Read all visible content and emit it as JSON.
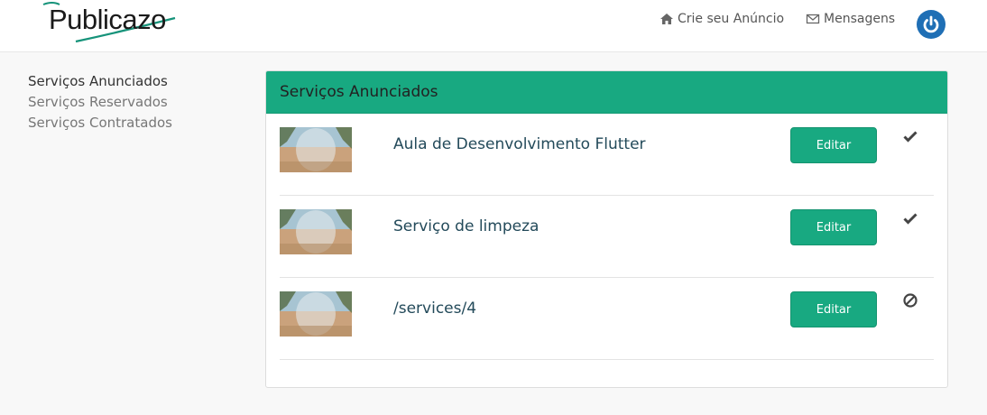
{
  "header": {
    "brand": "Publicazo",
    "nav_create": "Crie seu Anúncio",
    "nav_messages": "Mensagens",
    "accent": "#1f6fb5"
  },
  "sidebar": {
    "items": [
      {
        "label": "Serviços Anunciados",
        "active": true
      },
      {
        "label": "Serviços Reservados",
        "active": false
      },
      {
        "label": "Serviços Contratados",
        "active": false
      }
    ]
  },
  "panel": {
    "title": "Serviços Anunciados",
    "color": "#18a981",
    "services": [
      {
        "title": "Aula de Desenvolvimento Flutter",
        "edit_label": "Editar",
        "status_icon": "check-icon"
      },
      {
        "title": "Serviço de limpeza",
        "edit_label": "Editar",
        "status_icon": "check-icon"
      },
      {
        "title": "/services/4",
        "edit_label": "Editar",
        "status_icon": "ban-icon"
      }
    ]
  }
}
